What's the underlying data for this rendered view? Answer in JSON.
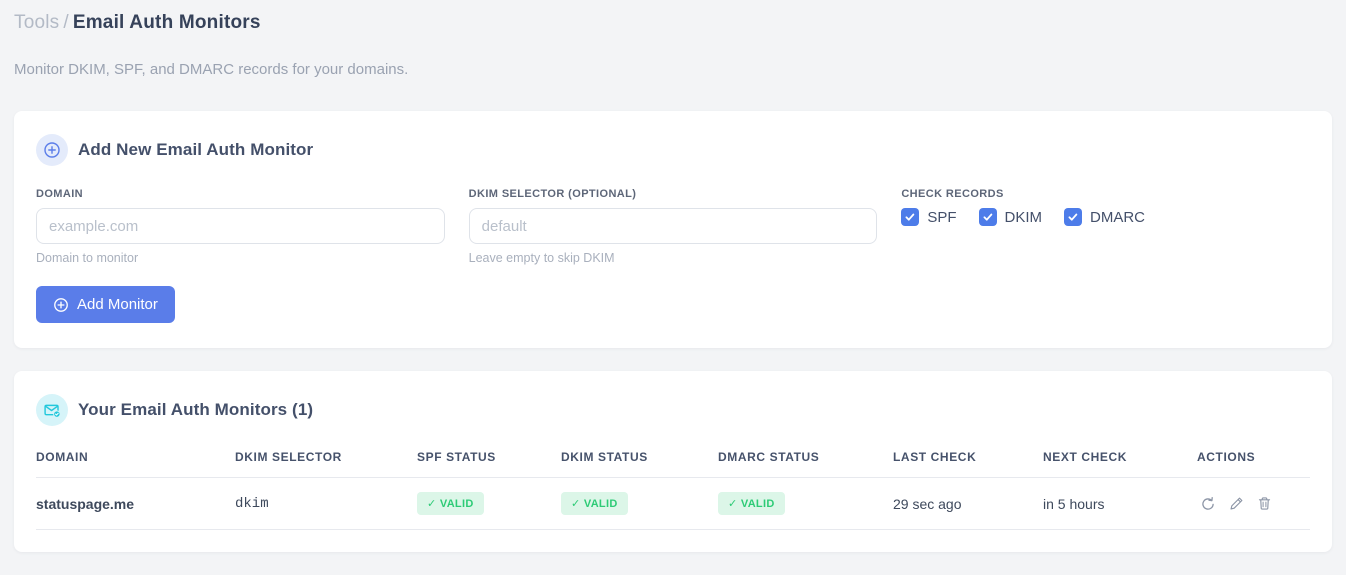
{
  "page": {
    "breadcrumb": {
      "section": "Tools",
      "separator": "/",
      "current": "Email Auth Monitors"
    },
    "subtitle": "Monitor DKIM, SPF, and DMARC records for your domains."
  },
  "colors": {
    "accent_blue": "#5a7de9",
    "checkbox_blue": "#4d7ce9",
    "valid_green": "#2dcb76",
    "valid_green_bg": "#dcf6e8",
    "selector_pink": "#ee3f7e",
    "icon_cyan": "#23c8dc",
    "icon_circle_blue_bg": "#e4ebfb",
    "icon_circle_cyan_bg": "#d6f4f9",
    "page_bg": "#f3f4f6"
  },
  "add_form": {
    "icon": "plus-circle-icon",
    "title": "Add New Email Auth Monitor",
    "fields": {
      "domain": {
        "label": "DOMAIN",
        "value": "",
        "placeholder": "example.com",
        "hint": "Domain to monitor"
      },
      "dkim_selector": {
        "label": "DKIM SELECTOR (OPTIONAL)",
        "value": "",
        "placeholder": "default",
        "hint": "Leave empty to skip DKIM"
      }
    },
    "check_records": {
      "label": "CHECK RECORDS",
      "options": [
        {
          "label": "SPF",
          "checked": true
        },
        {
          "label": "DKIM",
          "checked": true
        },
        {
          "label": "DMARC",
          "checked": true
        }
      ]
    },
    "submit_label": "Add Monitor"
  },
  "monitors": {
    "icon": "envelope-check-icon",
    "title": "Your Email Auth Monitors (1)",
    "count": 1,
    "table": {
      "headers": [
        "DOMAIN",
        "DKIM SELECTOR",
        "SPF STATUS",
        "DKIM STATUS",
        "DMARC STATUS",
        "LAST CHECK",
        "NEXT CHECK",
        "ACTIONS"
      ],
      "rows": [
        {
          "domain": "statuspage.me",
          "dkim_selector": "dkim",
          "spf_status": "✓ VALID",
          "dkim_status": "✓ VALID",
          "dmarc_status": "✓ VALID",
          "last_check": "29 sec ago",
          "next_check": "in 5 hours",
          "actions": [
            "refresh-icon",
            "edit-icon",
            "delete-icon"
          ]
        }
      ]
    }
  }
}
